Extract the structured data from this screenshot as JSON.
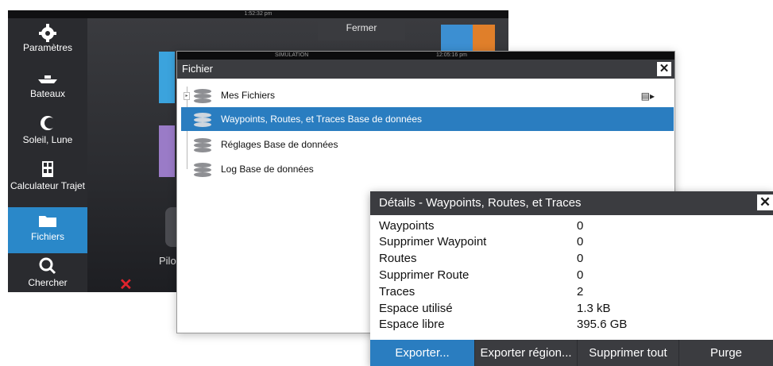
{
  "home": {
    "clock": "1:52:32 pm",
    "close_label": "Fermer",
    "pilot_label": "Pilo",
    "sidebar": [
      {
        "label": "Paramètres",
        "icon": "gear-icon"
      },
      {
        "label": "Bateaux",
        "icon": "ship-icon"
      },
      {
        "label": "Soleil, Lune",
        "icon": "sun-moon-icon"
      },
      {
        "label": "Calculateur Trajet",
        "icon": "calculator-icon"
      },
      {
        "label": "Fichiers",
        "icon": "folder-icon",
        "active": true
      },
      {
        "label": "Chercher",
        "icon": "search-icon"
      }
    ]
  },
  "file_dialog": {
    "status_left": "SIMULATION",
    "status_clock": "12:05:16 pm",
    "title": "Fichier",
    "items": [
      {
        "label": "Mes Fichiers"
      },
      {
        "label": "Waypoints, Routes, et Traces Base de données",
        "selected": true
      },
      {
        "label": "Réglages Base de données"
      },
      {
        "label": "Log Base de données"
      }
    ]
  },
  "details": {
    "title": "Détails - Waypoints, Routes, et Traces",
    "rows": [
      {
        "key": "Waypoints",
        "value": "0"
      },
      {
        "key": "Supprimer Waypoint",
        "value": "0"
      },
      {
        "key": "Routes",
        "value": "0"
      },
      {
        "key": "Supprimer Route",
        "value": "0"
      },
      {
        "key": "Traces",
        "value": "2"
      },
      {
        "key": "Espace utilisé",
        "value": "1.3 kB"
      },
      {
        "key": "Espace libre",
        "value": "395.6 GB"
      }
    ],
    "actions": [
      "Exporter...",
      "Exporter région...",
      "Supprimer tout",
      "Purge"
    ]
  },
  "colors": {
    "accent": "#2a7dc0",
    "titlebar": "#3b3c40",
    "home_bg": "#2f3034",
    "alert": "#e0242d"
  }
}
